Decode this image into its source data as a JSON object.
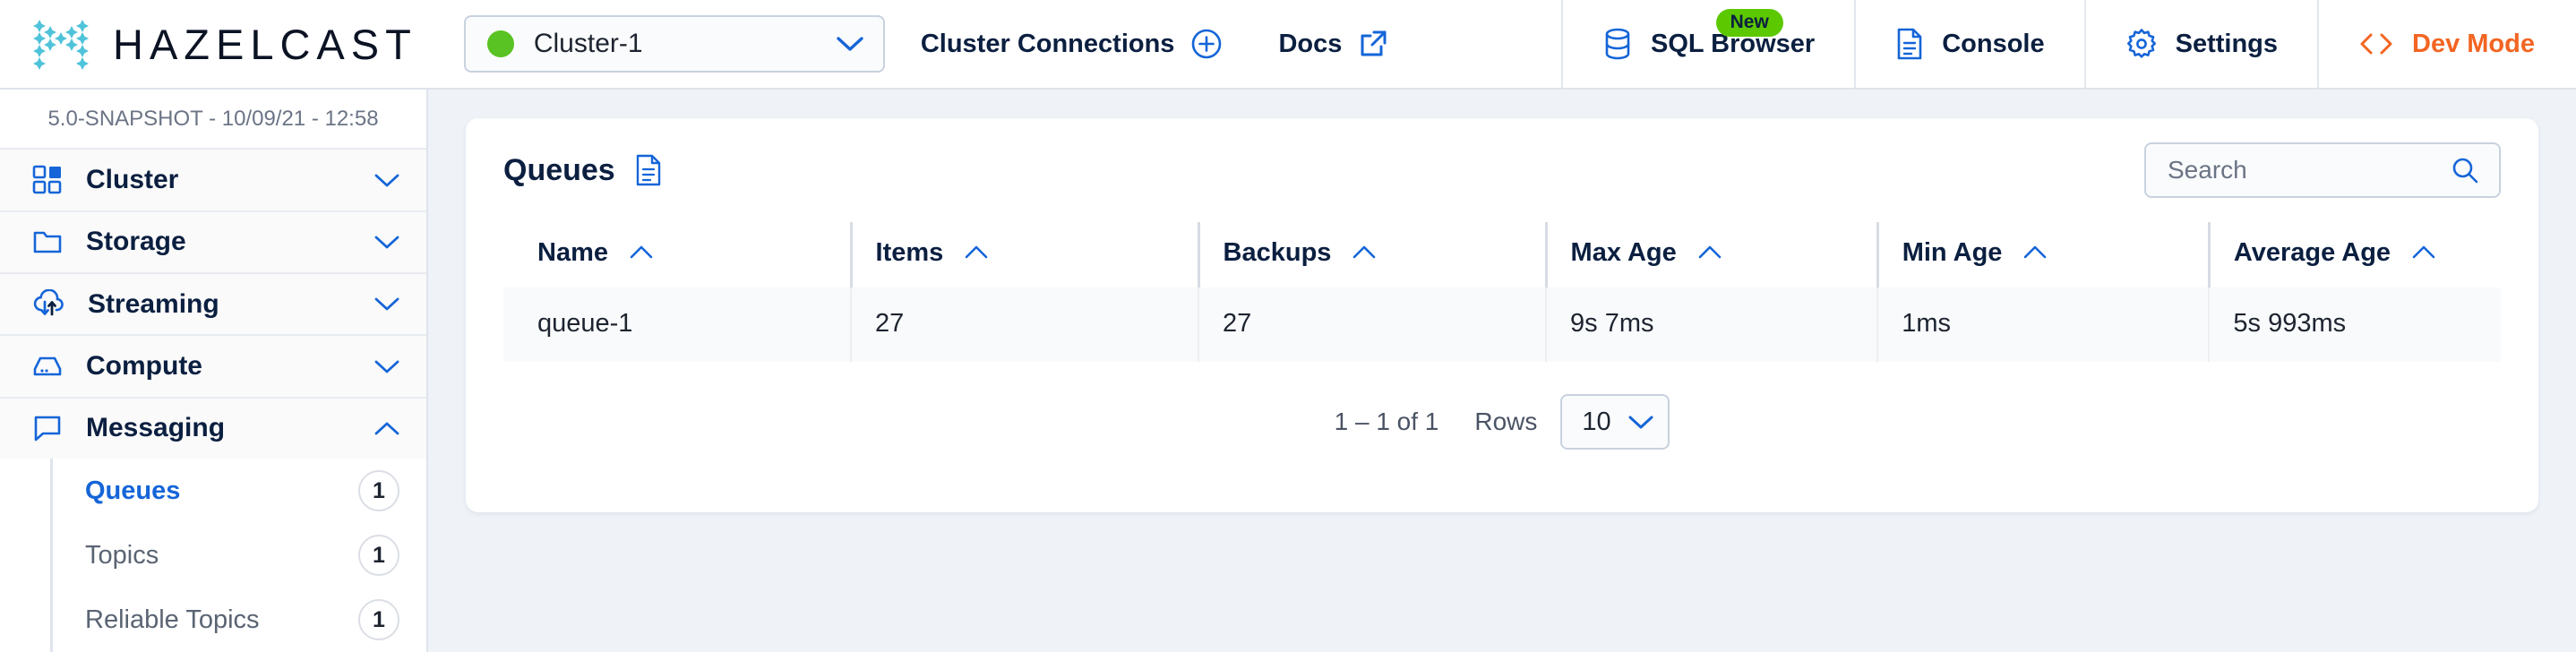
{
  "header": {
    "brand": "HAZELCAST",
    "logo_icon": "hazelcast-dot-h-logo",
    "cluster": {
      "name": "Cluster-1",
      "status_color": "#58c322",
      "status_icon": "status-dot",
      "chevron_icon": "chevron-down-icon"
    },
    "links": [
      {
        "label": "Cluster Connections",
        "icon": "plus-circle-icon"
      },
      {
        "label": "Docs",
        "icon": "external-link-icon"
      }
    ],
    "right_items": [
      {
        "label": "SQL Browser",
        "icon": "database-icon",
        "badge": "New",
        "badge_color": "#5cc800"
      },
      {
        "label": "Console",
        "icon": "console-document-icon"
      },
      {
        "label": "Settings",
        "icon": "gear-icon"
      },
      {
        "label": "Dev Mode",
        "icon": "code-brackets-icon",
        "color": "#f26522"
      }
    ]
  },
  "sidebar": {
    "version": "5.0-SNAPSHOT - 10/09/21 - 12:58",
    "groups": [
      {
        "label": "Cluster",
        "icon": "grid-icon",
        "chevron": "chevron-down-icon",
        "expanded": false
      },
      {
        "label": "Storage",
        "icon": "folder-icon",
        "chevron": "chevron-down-icon",
        "expanded": false
      },
      {
        "label": "Streaming",
        "icon": "cloud-sync-icon",
        "chevron": "chevron-down-icon",
        "expanded": false
      },
      {
        "label": "Compute",
        "icon": "server-icon",
        "chevron": "chevron-down-icon",
        "expanded": false
      },
      {
        "label": "Messaging",
        "icon": "chat-bubble-icon",
        "chevron": "chevron-up-icon",
        "expanded": true
      }
    ],
    "messaging_items": [
      {
        "label": "Queues",
        "count": "1",
        "active": true
      },
      {
        "label": "Topics",
        "count": "1",
        "active": false
      },
      {
        "label": "Reliable Topics",
        "count": "1",
        "active": false
      }
    ]
  },
  "main": {
    "card_title": "Queues",
    "card_title_icon": "document-icon",
    "search": {
      "placeholder": "Search",
      "value": "",
      "icon": "search-icon"
    },
    "table": {
      "sort_icon": "caret-up-icon",
      "columns": [
        "Name",
        "Items",
        "Backups",
        "Max Age",
        "Min Age",
        "Average Age"
      ],
      "rows": [
        {
          "name": "queue-1",
          "items": "27",
          "backups": "27",
          "max_age": "9s 7ms",
          "min_age": "1ms",
          "average_age": "5s 993ms"
        }
      ]
    },
    "pagination": {
      "range": "1 – 1 of 1",
      "rows_label": "Rows",
      "rows_per_page": "10",
      "chevron_icon": "chevron-down-icon"
    }
  }
}
